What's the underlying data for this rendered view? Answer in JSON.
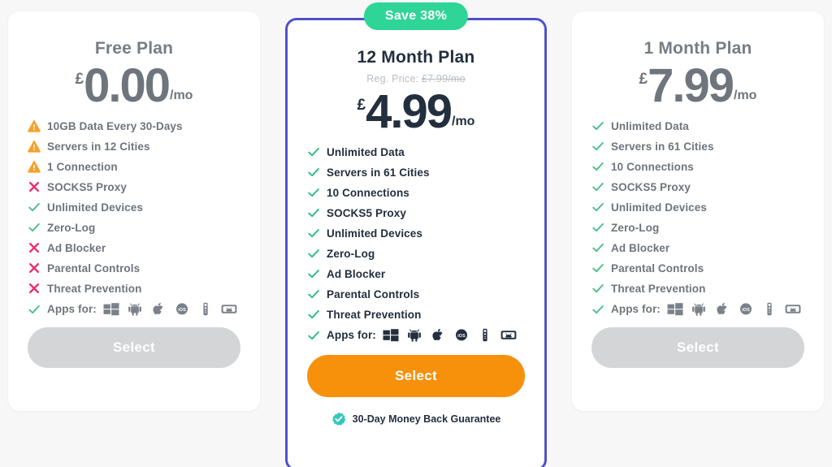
{
  "page": {
    "background_color": "#f7f7f8",
    "accent_color": "#4f51c9",
    "cta_color": "#f7900b",
    "badge_color": "#2fd597"
  },
  "plans": [
    {
      "id": "free",
      "title": "Free Plan",
      "currency": "£",
      "price": "0.00",
      "period": "/mo",
      "badge": null,
      "reg_price_label": null,
      "reg_price_value": null,
      "featured": false,
      "button_label": "Select",
      "guarantee": null,
      "apps_label": "Apps for:",
      "apps": [
        "windows-icon",
        "android-icon",
        "apple-icon",
        "ios-icon",
        "firestick-icon",
        "androidtv-icon"
      ],
      "features": [
        {
          "label": "10GB Data Every 30-Days",
          "status": "warn"
        },
        {
          "label": "Servers in 12 Cities",
          "status": "warn"
        },
        {
          "label": "1 Connection",
          "status": "warn"
        },
        {
          "label": "SOCKS5 Proxy",
          "status": "no"
        },
        {
          "label": "Unlimited Devices",
          "status": "yes"
        },
        {
          "label": "Zero-Log",
          "status": "yes"
        },
        {
          "label": "Ad Blocker",
          "status": "no"
        },
        {
          "label": "Parental Controls",
          "status": "no"
        },
        {
          "label": "Threat Prevention",
          "status": "no"
        }
      ]
    },
    {
      "id": "12-month",
      "title": "12 Month Plan",
      "currency": "£",
      "price": "4.99",
      "period": "/mo",
      "badge": "Save 38%",
      "reg_price_label": "Reg. Price:",
      "reg_price_value": "£7.99/mo",
      "featured": true,
      "button_label": "Select",
      "guarantee": "30-Day Money Back Guarantee",
      "apps_label": "Apps for:",
      "apps": [
        "windows-icon",
        "android-icon",
        "apple-icon",
        "ios-icon",
        "firestick-icon",
        "androidtv-icon"
      ],
      "features": [
        {
          "label": "Unlimited Data",
          "status": "yes"
        },
        {
          "label": "Servers in 61 Cities",
          "status": "yes"
        },
        {
          "label": "10 Connections",
          "status": "yes"
        },
        {
          "label": "SOCKS5 Proxy",
          "status": "yes"
        },
        {
          "label": "Unlimited Devices",
          "status": "yes"
        },
        {
          "label": "Zero-Log",
          "status": "yes"
        },
        {
          "label": "Ad Blocker",
          "status": "yes"
        },
        {
          "label": "Parental Controls",
          "status": "yes"
        },
        {
          "label": "Threat Prevention",
          "status": "yes"
        }
      ]
    },
    {
      "id": "1-month",
      "title": "1 Month Plan",
      "currency": "£",
      "price": "7.99",
      "period": "/mo",
      "badge": null,
      "reg_price_label": null,
      "reg_price_value": null,
      "featured": false,
      "button_label": "Select",
      "guarantee": null,
      "apps_label": "Apps for:",
      "apps": [
        "windows-icon",
        "android-icon",
        "apple-icon",
        "ios-icon",
        "firestick-icon",
        "androidtv-icon"
      ],
      "features": [
        {
          "label": "Unlimited Data",
          "status": "yes"
        },
        {
          "label": "Servers in 61 Cities",
          "status": "yes"
        },
        {
          "label": "10 Connections",
          "status": "yes"
        },
        {
          "label": "SOCKS5 Proxy",
          "status": "yes"
        },
        {
          "label": "Unlimited Devices",
          "status": "yes"
        },
        {
          "label": "Zero-Log",
          "status": "yes"
        },
        {
          "label": "Ad Blocker",
          "status": "yes"
        },
        {
          "label": "Parental Controls",
          "status": "yes"
        },
        {
          "label": "Threat Prevention",
          "status": "yes"
        }
      ]
    }
  ]
}
